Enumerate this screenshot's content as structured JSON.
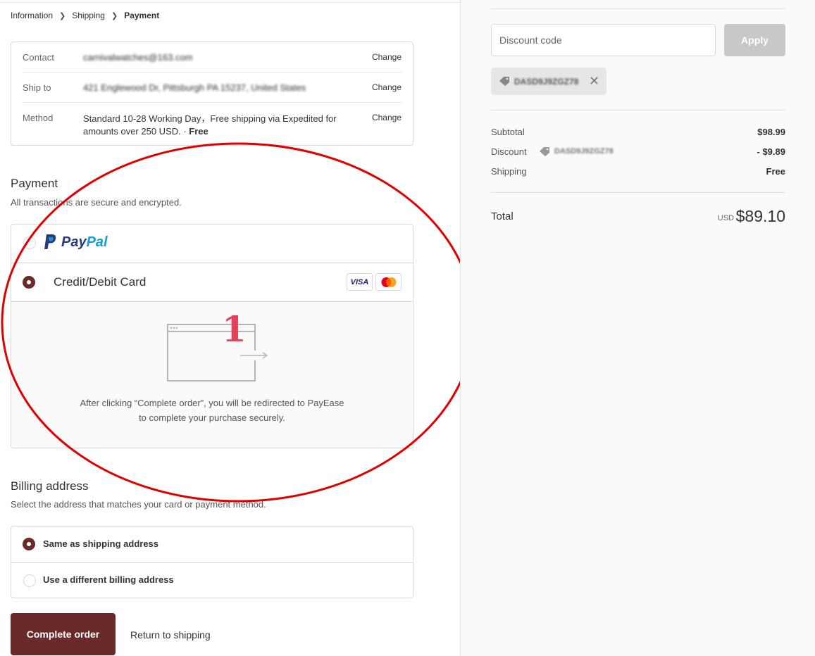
{
  "breadcrumb": {
    "items": [
      "Information",
      "Shipping",
      "Payment"
    ]
  },
  "review": {
    "contact_label": "Contact",
    "contact_value": "carnivalwatches@163.com",
    "shipto_label": "Ship to",
    "shipto_value": "421 Englewood Dr, Pittsburgh PA 15237, United States",
    "method_label": "Method",
    "method_value_line1": "Standard 10-28 Working Day，Free shipping via Expedited for",
    "method_value_line2": "amounts over 250 USD. · ",
    "method_value_free": "Free",
    "change_label": "Change"
  },
  "payment": {
    "title": "Payment",
    "subtitle": "All transactions are secure and encrypted.",
    "paypal_label_1": "Pay",
    "paypal_label_2": "Pal",
    "card_label": "Credit/Debit Card",
    "visa_label": "VISA",
    "redirect_line1": "After clicking “Complete order”, you will be redirected to PayEase",
    "redirect_line2": "to complete your purchase securely."
  },
  "annotation": {
    "number": "1",
    "color": "#e2425a",
    "ellipse_color": "#e00000"
  },
  "billing": {
    "title": "Billing address",
    "subtitle": "Select the address that matches your card or payment method.",
    "option_same": "Same as shipping address",
    "option_different": "Use a different billing address"
  },
  "actions": {
    "complete_order": "Complete order",
    "return_to_shipping": "Return to shipping"
  },
  "sidebar": {
    "discount_placeholder": "Discount code",
    "apply_label": "Apply",
    "applied_code": "DASD9J9ZGZ78",
    "subtotal_label": "Subtotal",
    "subtotal_value": "$98.99",
    "discount_label": "Discount",
    "discount_value": "- $9.89",
    "shipping_label": "Shipping",
    "shipping_value": "Free",
    "total_label": "Total",
    "currency": "USD",
    "total_value": "$89.10"
  },
  "colors": {
    "accent": "#6b2a2a",
    "paypal_dark": "#253b80",
    "paypal_light": "#179bd7"
  }
}
